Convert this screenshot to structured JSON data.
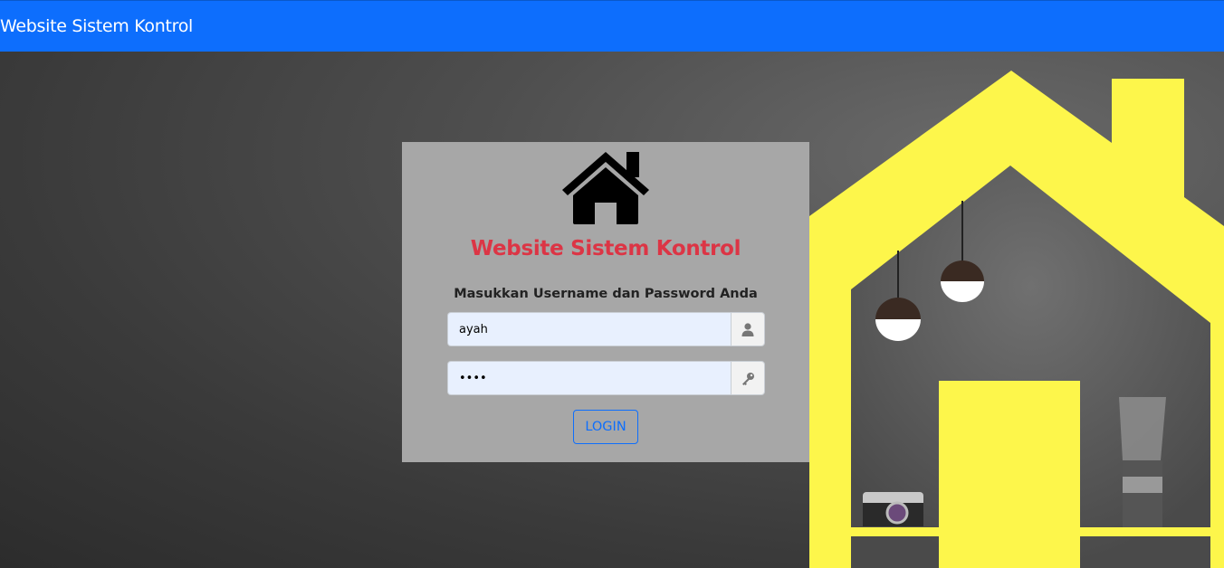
{
  "navbar": {
    "brand": "Website Sistem Kontrol"
  },
  "login_card": {
    "logo_icon": "house-icon",
    "title": "Website Sistem Kontrol",
    "subtitle": "Masukkan Username dan Password Anda",
    "username": {
      "value": "ayah",
      "icon": "user-icon"
    },
    "password": {
      "value": "••••",
      "icon": "key-icon"
    },
    "login_label": "LOGIN"
  },
  "colors": {
    "navbar": "#0d6efd",
    "card_bg": "#a7a7a7",
    "title": "#dc3545",
    "button": "#0d6efd",
    "house_outline": "#fdf64b"
  }
}
